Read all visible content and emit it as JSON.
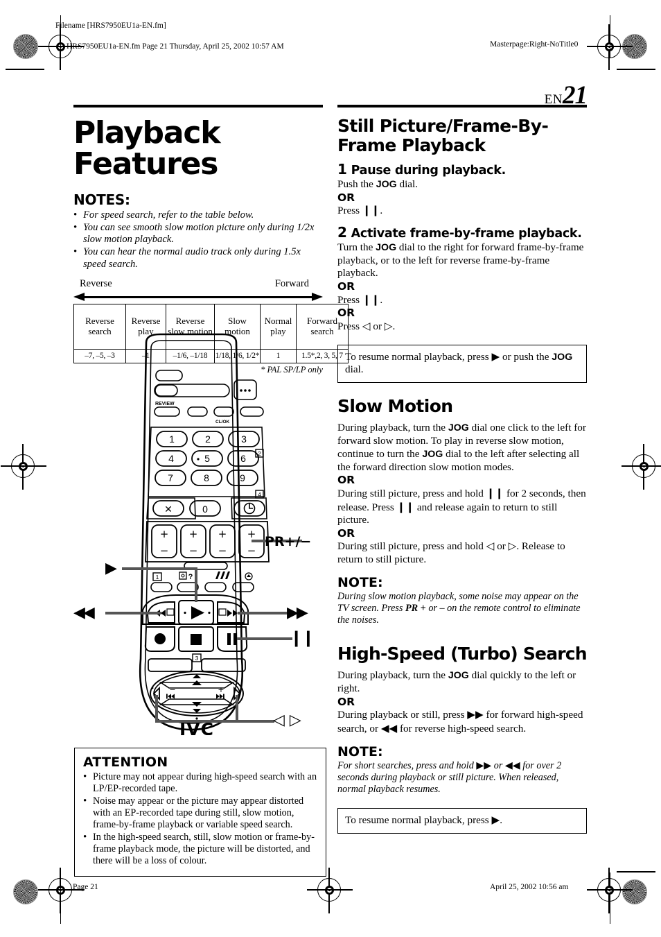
{
  "page_meta": {
    "filename_label": "Filename [HRS7950EU1a-EN.fm]",
    "header_line": "HRS7950EU1a-EN.fm  Page 21  Thursday, April 25, 2002  10:57 AM",
    "masterpage": "Masterpage:Right-NoTitle0",
    "footer_page": "Page 21",
    "footer_date": "April 25, 2002 10:56 am"
  },
  "page_number": {
    "lang": "EN",
    "number": "21"
  },
  "left_column": {
    "title": "Playback Features",
    "notes_heading": "NOTES:",
    "notes": [
      "For speed search, refer to the table below.",
      "You can see smooth slow motion picture only during 1/2x slow motion playback.",
      "You can hear the normal audio track only during 1.5x speed search."
    ],
    "direction_left": "Reverse",
    "direction_right": "Forward",
    "speed_table": {
      "headers": [
        "Reverse search",
        "Reverse play",
        "Reverse slow motion",
        "Slow motion",
        "Normal play",
        "Forward search"
      ],
      "values": [
        "–7, –5, –3",
        "–1",
        "–1/6, –1/18",
        "1/18, 1/6, 1/2*",
        "1",
        "1.5*,2, 3, 5, 7"
      ]
    },
    "table_footnote": "* PAL SP/LP only"
  },
  "remote": {
    "brand": "JVC",
    "keypad": [
      "1",
      "2",
      "3",
      "4",
      "5",
      "6",
      "7",
      "8",
      "9",
      "0"
    ],
    "cancel_key": "✕",
    "timer_key": "timer-icon",
    "callouts": [
      {
        "name": "pr-plus-minus",
        "label": "PR+/−"
      },
      {
        "name": "play",
        "label": "▶"
      },
      {
        "name": "rewind",
        "label": "◀◀"
      },
      {
        "name": "fast-forward",
        "label": "▶▶"
      },
      {
        "name": "pause",
        "label": "❙❙"
      },
      {
        "name": "left-right",
        "label": "◁ ▷"
      }
    ],
    "review_label": "REVIEW",
    "step_markers": [
      "1",
      "2",
      "3",
      "4"
    ]
  },
  "attention": {
    "heading": "ATTENTION",
    "items": [
      "Picture may not appear during high-speed search with an LP/EP-recorded tape.",
      "Noise may appear or the picture may appear distorted with an EP-recorded tape during still, slow motion, frame-by-frame playback or variable speed search.",
      "In the high-speed search, still, slow motion or frame-by-frame playback mode, the picture will be distorted, and there will be a loss of colour."
    ]
  },
  "right_column": {
    "section1": {
      "title": "Still Picture/Frame-By-Frame Playback",
      "step1": {
        "num": "1",
        "heading": "Pause during playback.",
        "line1_pre": "Push the ",
        "line1_bold": "JOG",
        "line1_post": " dial.",
        "or": "OR",
        "line2_pre": "Press ",
        "line2_glyph": "❙❙",
        "line2_post": "."
      },
      "step2": {
        "num": "2",
        "heading": "Activate frame-by-frame playback.",
        "line1_pre": "Turn the ",
        "line1_bold": "JOG",
        "line1_post": " dial to the right for forward frame-by-frame playback, or to the left for reverse frame-by-frame playback.",
        "or1": "OR",
        "line2_pre": "Press ",
        "line2_glyph": "❙❙",
        "line2_post": ".",
        "or2": "OR",
        "line3_pre": "Press ",
        "line3_glyph1": "◁",
        "line3_mid": " or ",
        "line3_glyph2": "▷",
        "line3_post": "."
      },
      "resume_box": {
        "pre": "To resume normal playback, press ",
        "glyph": "▶",
        "mid": " or push the ",
        "bold": "JOG",
        "post": " dial."
      }
    },
    "section2": {
      "title": "Slow Motion",
      "para1_a": "During playback, turn the ",
      "para1_bold1": "JOG",
      "para1_b": " dial one click to the left for forward slow motion. To play in reverse slow motion, continue to turn the ",
      "para1_bold2": "JOG",
      "para1_c": " dial to the left after selecting all the forward direction slow motion modes.",
      "or1": "OR",
      "para2_a": "During still picture, press and hold ",
      "para2_glyph1": "❙❙",
      "para2_b": " for 2 seconds, then release. Press ",
      "para2_glyph2": "❙❙",
      "para2_c": " and release again to return to still picture.",
      "or2": "OR",
      "para3_a": "During still picture, press and hold ",
      "para3_glyph1": "◁",
      "para3_b": " or ",
      "para3_glyph2": "▷",
      "para3_c": ". Release to return to still picture.",
      "note_heading": "NOTE:",
      "note_a": "During slow motion playback, some noise may appear on the TV screen. Press ",
      "note_bold": "PR +",
      "note_b": " or – on the remote control to eliminate the noises."
    },
    "section3": {
      "title": "High-Speed (Turbo) Search",
      "para1_a": "During playback, turn the ",
      "para1_bold": "JOG",
      "para1_b": " dial quickly to the left or right.",
      "or1": "OR",
      "para2_a": "During playback or still, press ",
      "para2_glyph1": "▶▶",
      "para2_b": " for forward high-speed search, or ",
      "para2_glyph2": "◀◀",
      "para2_c": " for reverse high-speed search.",
      "note_heading": "NOTE:",
      "note_a": "For short searches, press and hold ",
      "note_glyph1": "▶▶",
      "note_b": " or ",
      "note_glyph2": "◀◀",
      "note_c": " for over 2 seconds during playback or still picture. When released, normal playback resumes.",
      "resume_box": {
        "pre": "To resume normal playback, press ",
        "glyph": "▶",
        "post": "."
      }
    }
  }
}
